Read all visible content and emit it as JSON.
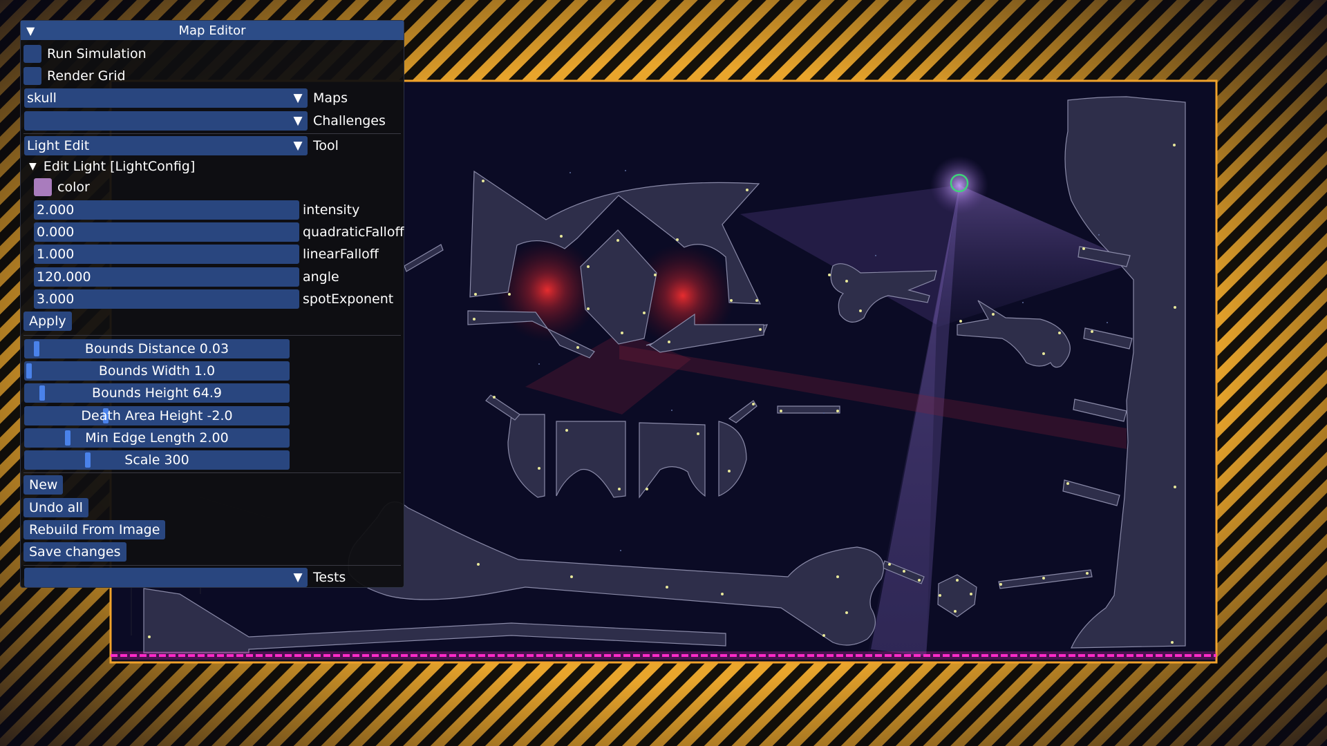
{
  "panel": {
    "title": "Map Editor",
    "run_simulation": {
      "label": "Run Simulation",
      "checked": false
    },
    "render_grid": {
      "label": "Render Grid",
      "checked": false
    },
    "maps": {
      "value": "skull",
      "label": "Maps"
    },
    "challenges": {
      "value": "",
      "label": "Challenges"
    },
    "tool": {
      "value": "Light Edit",
      "label": "Tool"
    },
    "edit_light": {
      "header": "Edit Light [LightConfig]",
      "color_label": "color",
      "color": "#a97cbd",
      "fields": [
        {
          "value": "2.000",
          "label": "intensity"
        },
        {
          "value": "0.000",
          "label": "quadraticFalloff"
        },
        {
          "value": "1.000",
          "label": "linearFalloff"
        },
        {
          "value": "120.000",
          "label": "angle"
        },
        {
          "value": "3.000",
          "label": "spotExponent"
        }
      ],
      "apply_label": "Apply"
    },
    "sliders": [
      {
        "text": "Bounds Distance 0.03",
        "fraction": 0.03
      },
      {
        "text": "Bounds Width 1.0",
        "fraction": 0.0
      },
      {
        "text": "Bounds Height 64.9",
        "fraction": 0.05
      },
      {
        "text": "Death Area Height -2.0",
        "fraction": 0.3
      },
      {
        "text": "Min Edge Length 2.00",
        "fraction": 0.15
      },
      {
        "text": "Scale 300",
        "fraction": 0.23
      }
    ],
    "buttons": {
      "new": "New",
      "undo_all": "Undo all",
      "rebuild": "Rebuild From Image",
      "save": "Save changes"
    },
    "tests": {
      "value": "",
      "label": "Tests"
    }
  },
  "colors": {
    "accent": "#29467f",
    "title_bar": "#2c4c87",
    "slider_grab": "#4a82ea",
    "hazard_yellow": "#f2ae2e",
    "death_line": "#ff2ac8",
    "light_ring": "#3fd47a"
  }
}
